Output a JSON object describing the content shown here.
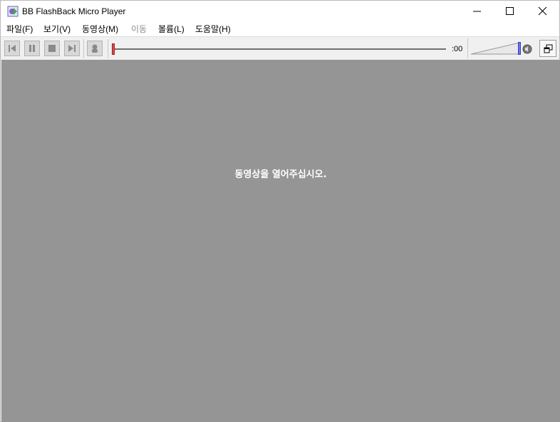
{
  "window": {
    "title": "BB FlashBack Micro Player",
    "controls": {
      "minimize": "minimize-icon",
      "maximize": "maximize-icon",
      "close": "close-icon"
    }
  },
  "menu": {
    "items": [
      {
        "label": "파일(F)",
        "enabled": true
      },
      {
        "label": "보기(V)",
        "enabled": true
      },
      {
        "label": "동영상(M)",
        "enabled": true
      },
      {
        "label": "이동",
        "enabled": false
      },
      {
        "label": "볼륨(L)",
        "enabled": true
      },
      {
        "label": "도움말(H)",
        "enabled": true
      }
    ]
  },
  "toolbar": {
    "buttons": [
      "skip-back-icon",
      "pause-icon",
      "stop-icon",
      "skip-forward-icon",
      "speaker-person-icon"
    ],
    "seek": {
      "position": 0,
      "time_label": ":00"
    },
    "volume": {
      "level": 1.0,
      "icon": "speaker-icon"
    },
    "view_button": "window-mode-icon"
  },
  "video": {
    "message": "동영상을 열어주십시오.",
    "background": "#959595"
  },
  "colors": {
    "seek_thumb": "#e04a4a",
    "volume_thumb": "#6c74ff"
  }
}
